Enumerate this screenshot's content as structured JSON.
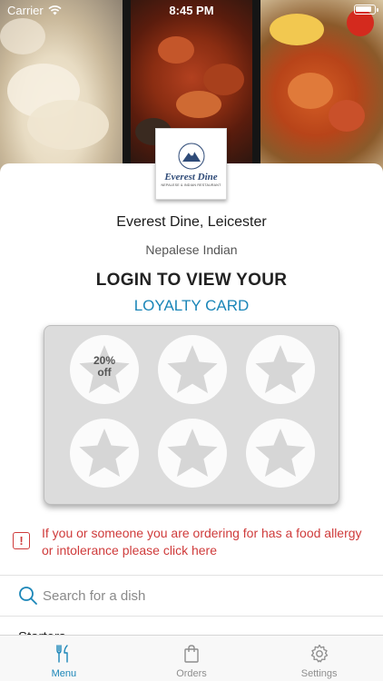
{
  "status_bar": {
    "carrier": "Carrier",
    "time": "8:45 PM",
    "battery_level": 0.95
  },
  "hero": {
    "icons": [
      "momo-photo",
      "tandoori-photo",
      "curry-photo"
    ]
  },
  "restaurant": {
    "logo_name": "Everest Dine",
    "logo_arc_text": "EVEREST DINE",
    "logo_subtitle": "NEPALESE & INDIAN RESTAURANT",
    "name": "Everest Dine, Leicester",
    "cuisine": "Nepalese Indian"
  },
  "loyalty": {
    "title": "LOGIN TO VIEW YOUR",
    "link_label": "LOYALTY CARD",
    "reward": {
      "line1": "20%",
      "line2": "off"
    },
    "stamps_total": 6
  },
  "allergy": {
    "text": "If you or someone you are ordering for has a food allergy or intolerance please click here"
  },
  "search": {
    "placeholder": "Search for a dish"
  },
  "menu": {
    "first_category_peek": "Starters"
  },
  "tabs": [
    {
      "label": "Menu",
      "icon": "fork-knife-icon",
      "active": true
    },
    {
      "label": "Orders",
      "icon": "shopping-bag-icon",
      "active": false
    },
    {
      "label": "Settings",
      "icon": "gear-icon",
      "active": false
    }
  ],
  "colors": {
    "accent": "#1b86b8",
    "alert": "#cf3b3b",
    "card_bg": "#dcdcdc",
    "tab_inactive": "#8e8e8e"
  }
}
